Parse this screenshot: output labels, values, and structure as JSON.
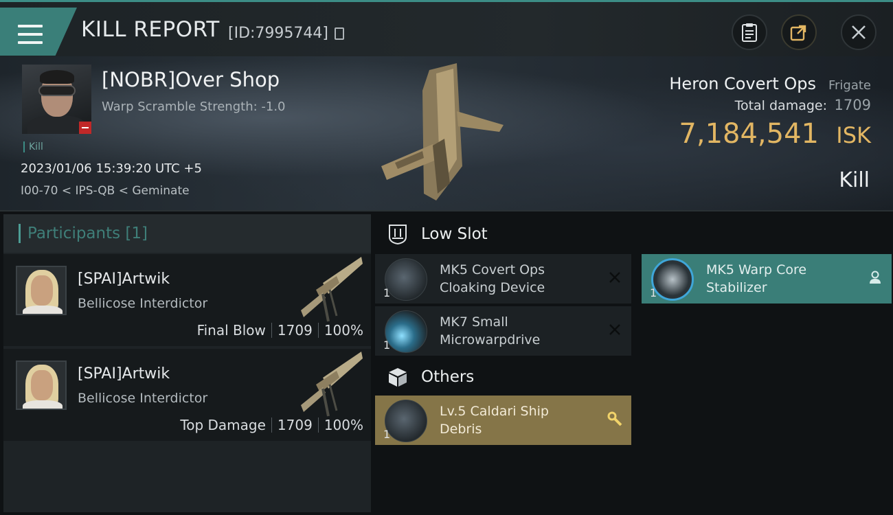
{
  "header": {
    "title": "KILL REPORT",
    "report_id": "[ID:7995744]",
    "icons": [
      "menu-icon",
      "copy-icon",
      "clipboard-icon",
      "share-icon",
      "close-icon"
    ]
  },
  "victim": {
    "name": "[NOBR]Over Shop",
    "warp_scramble": "Warp Scramble Strength: -1.0",
    "tag": "Kill",
    "datetime": "2023/01/06 15:39:20 UTC +5",
    "location": "I00-70 < IPS-QB < Geminate",
    "ship_name": "Heron Covert Ops",
    "ship_class": "Frigate",
    "total_damage_label": "Total damage:",
    "total_damage": "1709",
    "isk_value": "7,184,541",
    "isk_unit": "ISK",
    "result": "Kill"
  },
  "participants": {
    "title": "Participants",
    "count": "[1]",
    "rows": [
      {
        "name": "[SPAI]Artwik",
        "ship": "Bellicose Interdictor",
        "role": "Final Blow",
        "damage": "1709",
        "percent": "100%"
      },
      {
        "name": "[SPAI]Artwik",
        "ship": "Bellicose Interdictor",
        "role": "Top Damage",
        "damage": "1709",
        "percent": "100%"
      }
    ]
  },
  "sections": {
    "low_slot": "Low Slot",
    "others": "Others"
  },
  "items": {
    "covert": {
      "qty": "1",
      "line1": "MK5 Covert Ops",
      "line2": "Cloaking Device",
      "state": "destroyed"
    },
    "mwd": {
      "qty": "1",
      "line1": "MK7 Small",
      "line2": "Microwarpdrive",
      "state": "destroyed"
    },
    "wcs": {
      "qty": "1",
      "line1": "MK5 Warp Core",
      "line2": "Stabilizer",
      "state": "dropped"
    },
    "debris": {
      "qty": "1",
      "line1": "Lv.5 Caldari Ship",
      "line2": "Debris",
      "state": "salvage"
    }
  },
  "colors": {
    "accent": "#3c8d86",
    "isk": "#e2b663",
    "dropped_item_bg": "#3a7e78",
    "debris_item_bg": "#857548",
    "destroyed_item_bg": "#1c2124"
  }
}
